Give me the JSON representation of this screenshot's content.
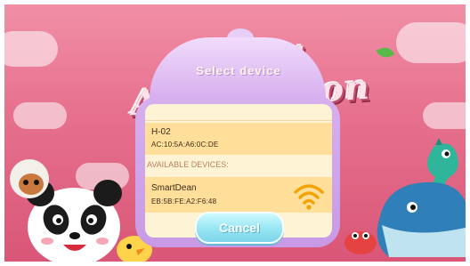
{
  "background": {
    "banner_text": "Enjoy Atomization"
  },
  "dialog": {
    "title": "Select device",
    "paired_device": {
      "name": "H-02",
      "mac": "AC:10:5A:A6:0C:DE"
    },
    "section_label": "AVAILABLE DEVICES:",
    "available_devices": [
      {
        "name": "SmartDean",
        "mac": "EB:5B:FE:A2:F6:48",
        "signal_icon": "wifi-icon"
      }
    ],
    "cancel_label": "Cancel"
  },
  "colors": {
    "background_pink": "#e7728f",
    "dialog_purple": "#d7b0ef",
    "panel_cream": "#fff3d6",
    "row_yellow": "#ffdf9a",
    "wifi_orange": "#f5a200",
    "cancel_cyan": "#93e3f2"
  }
}
